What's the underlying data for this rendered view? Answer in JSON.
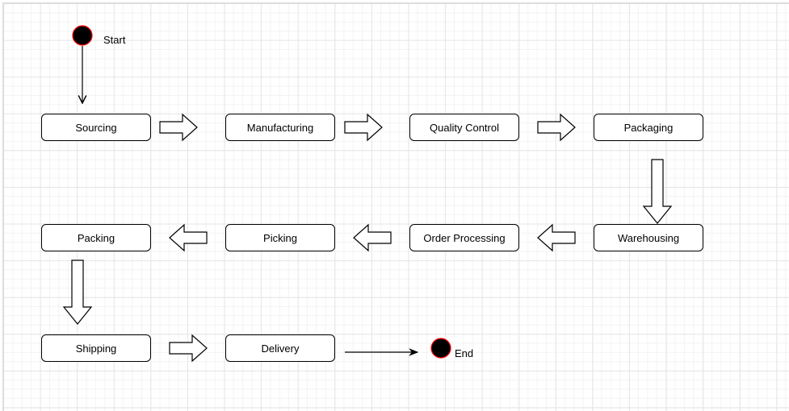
{
  "diagram": {
    "start_label": "Start",
    "end_label": "End",
    "steps": [
      "Sourcing",
      "Manufacturing",
      "Quality Control",
      "Packaging",
      "Warehousing",
      "Order Processing",
      "Picking",
      "Packing",
      "Shipping",
      "Delivery"
    ],
    "colors": {
      "node_fill": "#000000",
      "node_stroke": "#ff0000",
      "box_stroke": "#000000"
    }
  }
}
